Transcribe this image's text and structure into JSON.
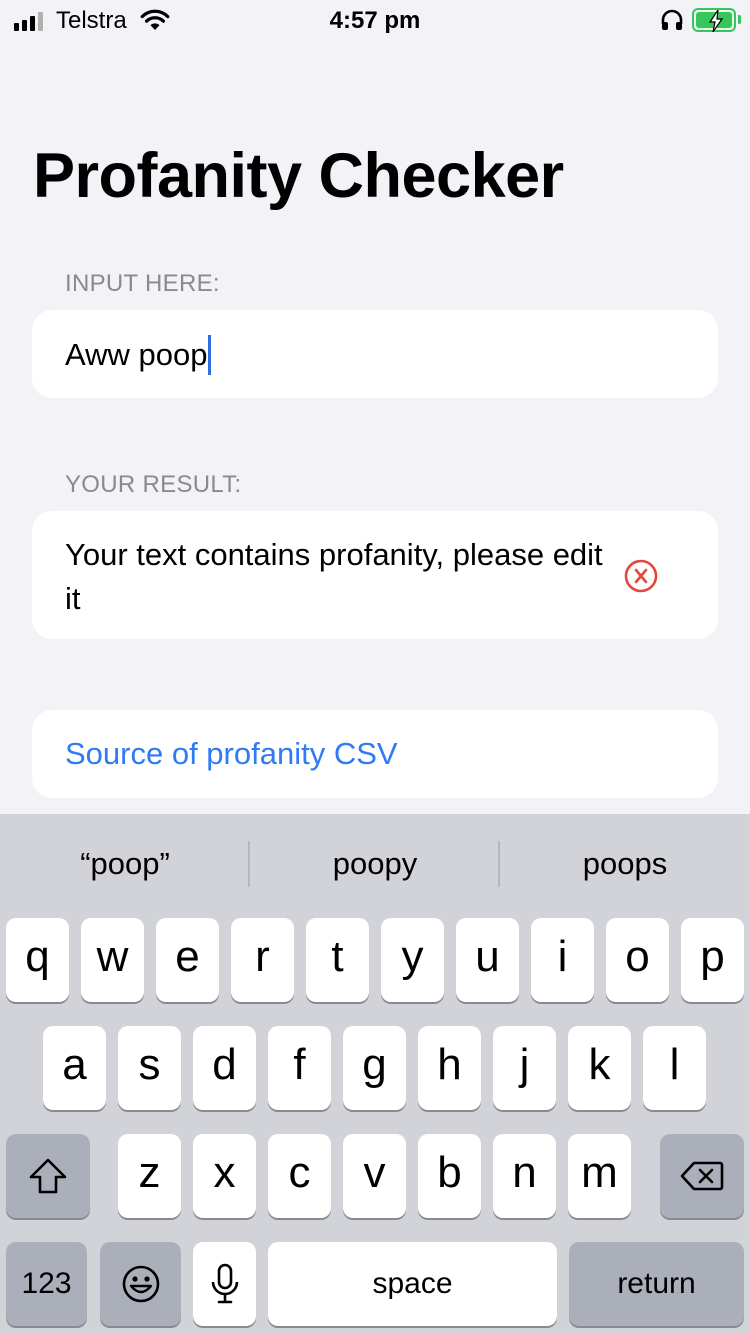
{
  "status_bar": {
    "carrier": "Telstra",
    "time": "4:57 pm",
    "signal_bars_active": 3,
    "signal_bars_total": 4,
    "wifi_icon": "wifi-icon",
    "headphones_icon": "headphones-icon",
    "battery_icon": "battery-charging-icon",
    "battery_color": "#34c759"
  },
  "page": {
    "title": "Profanity Checker"
  },
  "input_section": {
    "label": "INPUT HERE:",
    "value": "Aww poop"
  },
  "result_section": {
    "label": "YOUR RESULT:",
    "text": "Your text contains profanity, please edit it",
    "status_icon": "x-circle-icon",
    "status_color": "#e0493c"
  },
  "link": {
    "label": "Source of profanity CSV",
    "color": "#2f7af5"
  },
  "keyboard": {
    "suggestions": [
      "“poop”",
      "poopy",
      "poops"
    ],
    "row1": [
      "q",
      "w",
      "e",
      "r",
      "t",
      "y",
      "u",
      "i",
      "o",
      "p"
    ],
    "row2": [
      "a",
      "s",
      "d",
      "f",
      "g",
      "h",
      "j",
      "k",
      "l"
    ],
    "row3": [
      "z",
      "x",
      "c",
      "v",
      "b",
      "n",
      "m"
    ],
    "shift_icon": "shift-icon",
    "delete_icon": "backspace-icon",
    "numbers_label": "123",
    "emoji_icon": "emoji-icon",
    "mic_icon": "microphone-icon",
    "space_label": "space",
    "return_label": "return"
  }
}
